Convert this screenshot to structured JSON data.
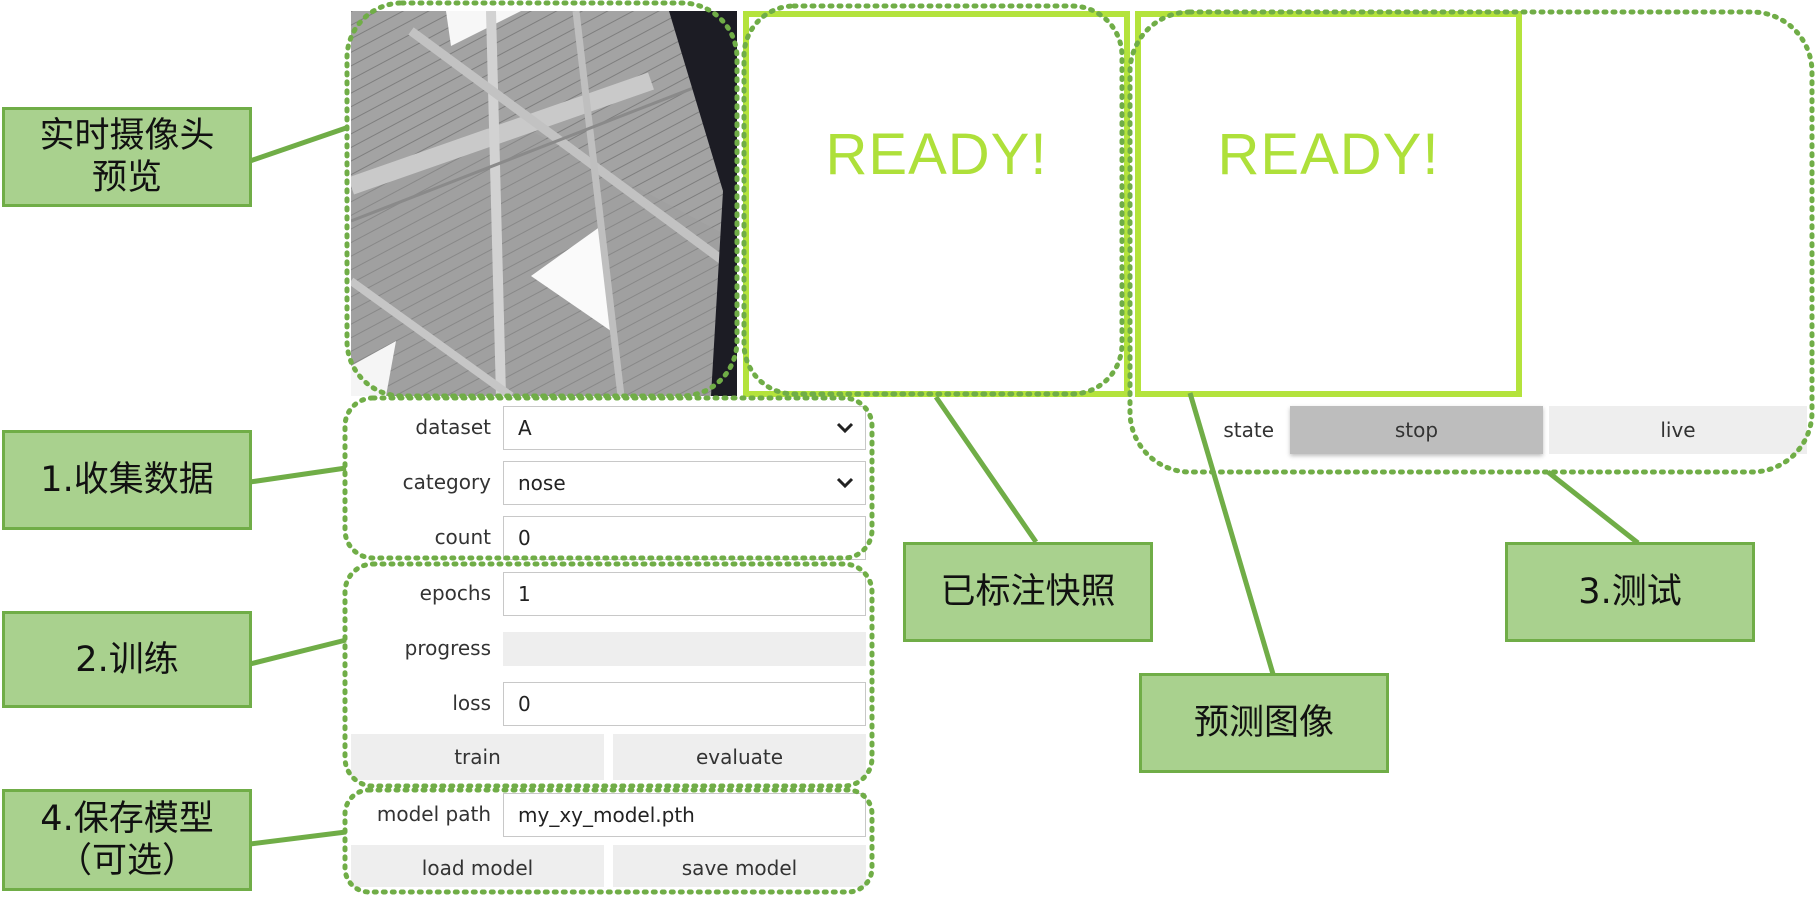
{
  "preview": {
    "ready_text_1": "READY!",
    "ready_text_2": "READY!"
  },
  "collect": {
    "dataset_label": "dataset",
    "dataset_value": "A",
    "category_label": "category",
    "category_value": "nose",
    "count_label": "count",
    "count_value": "0"
  },
  "train": {
    "epochs_label": "epochs",
    "epochs_value": "1",
    "progress_label": "progress",
    "progress_value": 0,
    "loss_label": "loss",
    "loss_value": "0",
    "train_button": "train",
    "evaluate_button": "evaluate"
  },
  "save": {
    "model_path_label": "model path",
    "model_path_value": "my_xy_model.pth",
    "load_button": "load model",
    "save_button": "save model"
  },
  "test": {
    "state_label": "state",
    "stop_button": "stop",
    "live_button": "live"
  },
  "annotations": {
    "camera_preview": "实时摄像头\n预览",
    "collect_data": "1.收集数据",
    "train": "2.训练",
    "save_model": "4.保存模型\n（可选）",
    "annotated_snapshot": "已标注快照",
    "prediction_image": "预测图像",
    "test": "3.测试"
  },
  "colors": {
    "callout_fill": "#a9d18e",
    "callout_border": "#70ad47",
    "ready_accent": "#b4e33c",
    "dotted_outline": "#70ad47"
  }
}
